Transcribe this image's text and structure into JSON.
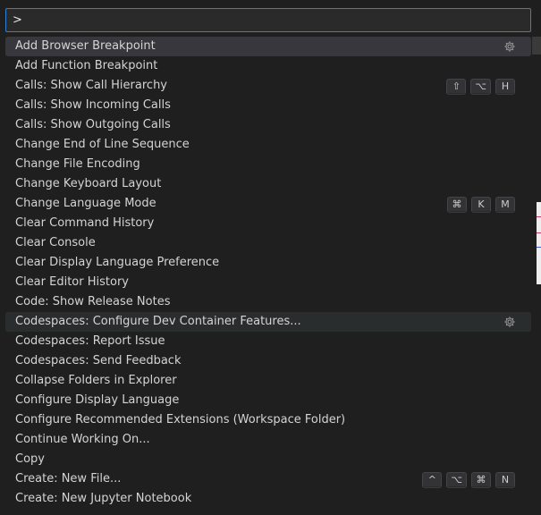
{
  "command_palette": {
    "input_value": ">",
    "items": [
      {
        "label": "Add Browser Breakpoint",
        "keys": [],
        "gear": true
      },
      {
        "label": "Add Function Breakpoint",
        "keys": [],
        "gear": false
      },
      {
        "label": "Calls: Show Call Hierarchy",
        "keys": [
          "⇧",
          "⌥",
          "H"
        ],
        "gear": false
      },
      {
        "label": "Calls: Show Incoming Calls",
        "keys": [],
        "gear": false
      },
      {
        "label": "Calls: Show Outgoing Calls",
        "keys": [],
        "gear": false
      },
      {
        "label": "Change End of Line Sequence",
        "keys": [],
        "gear": false
      },
      {
        "label": "Change File Encoding",
        "keys": [],
        "gear": false
      },
      {
        "label": "Change Keyboard Layout",
        "keys": [],
        "gear": false
      },
      {
        "label": "Change Language Mode",
        "keys": [
          "⌘",
          "K",
          "M"
        ],
        "gear": false
      },
      {
        "label": "Clear Command History",
        "keys": [],
        "gear": false
      },
      {
        "label": "Clear Console",
        "keys": [],
        "gear": false
      },
      {
        "label": "Clear Display Language Preference",
        "keys": [],
        "gear": false
      },
      {
        "label": "Clear Editor History",
        "keys": [],
        "gear": false
      },
      {
        "label": "Code: Show Release Notes",
        "keys": [],
        "gear": false
      },
      {
        "label": "Codespaces: Configure Dev Container Features...",
        "keys": [],
        "gear": true
      },
      {
        "label": "Codespaces: Report Issue",
        "keys": [],
        "gear": false
      },
      {
        "label": "Codespaces: Send Feedback",
        "keys": [],
        "gear": false
      },
      {
        "label": "Collapse Folders in Explorer",
        "keys": [],
        "gear": false
      },
      {
        "label": "Configure Display Language",
        "keys": [],
        "gear": false
      },
      {
        "label": "Configure Recommended Extensions (Workspace Folder)",
        "keys": [],
        "gear": false
      },
      {
        "label": "Continue Working On...",
        "keys": [],
        "gear": false
      },
      {
        "label": "Copy",
        "keys": [],
        "gear": false
      },
      {
        "label": "Create: New File...",
        "keys": [
          "^",
          "⌥",
          "⌘",
          "N"
        ],
        "gear": false
      },
      {
        "label": "Create: New Jupyter Notebook",
        "keys": [],
        "gear": false
      }
    ]
  },
  "colors": {
    "input_border": "#2f7fd4",
    "selected_row": "#37373d",
    "hovered_row": "#2a2d2e",
    "text": "#d4d4d4"
  },
  "icons": {
    "gear": "gear-icon"
  }
}
